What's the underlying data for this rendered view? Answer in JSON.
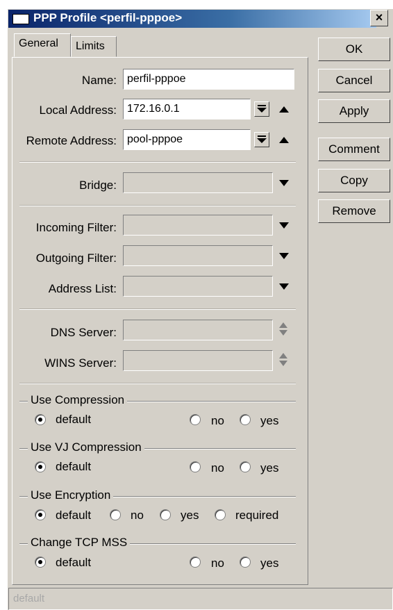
{
  "window": {
    "title": "PPP Profile <perfil-pppoe>",
    "close_glyph": "×"
  },
  "tabs": [
    {
      "label": "General"
    },
    {
      "label": "Limits"
    }
  ],
  "buttons": {
    "ok": "OK",
    "cancel": "Cancel",
    "apply": "Apply",
    "comment": "Comment",
    "copy": "Copy",
    "remove": "Remove"
  },
  "fields": {
    "name": {
      "label": "Name:",
      "value": "perfil-pppoe"
    },
    "local_address": {
      "label": "Local Address:",
      "value": "172.16.0.1"
    },
    "remote_address": {
      "label": "Remote Address:",
      "value": "pool-pppoe"
    },
    "bridge": {
      "label": "Bridge:",
      "value": ""
    },
    "incoming_filter": {
      "label": "Incoming Filter:",
      "value": ""
    },
    "outgoing_filter": {
      "label": "Outgoing Filter:",
      "value": ""
    },
    "address_list": {
      "label": "Address List:",
      "value": ""
    },
    "dns_server": {
      "label": "DNS Server:",
      "value": ""
    },
    "wins_server": {
      "label": "WINS Server:",
      "value": ""
    }
  },
  "groups": {
    "use_compression": {
      "title": "Use Compression",
      "options": {
        "default": "default",
        "no": "no",
        "yes": "yes"
      },
      "selected": "default"
    },
    "use_vj_compression": {
      "title": "Use VJ Compression",
      "options": {
        "default": "default",
        "no": "no",
        "yes": "yes"
      },
      "selected": "default"
    },
    "use_encryption": {
      "title": "Use Encryption",
      "options": {
        "default": "default",
        "no": "no",
        "yes": "yes",
        "required": "required"
      },
      "selected": "default"
    },
    "change_tcp_mss": {
      "title": "Change TCP MSS",
      "options": {
        "default": "default",
        "no": "no",
        "yes": "yes"
      },
      "selected": "default"
    }
  },
  "status": {
    "text": "default"
  },
  "icons": [
    "window-icon",
    "close-icon",
    "dropdown-arrow-icon",
    "up-arrow-icon",
    "spinner-icon"
  ]
}
